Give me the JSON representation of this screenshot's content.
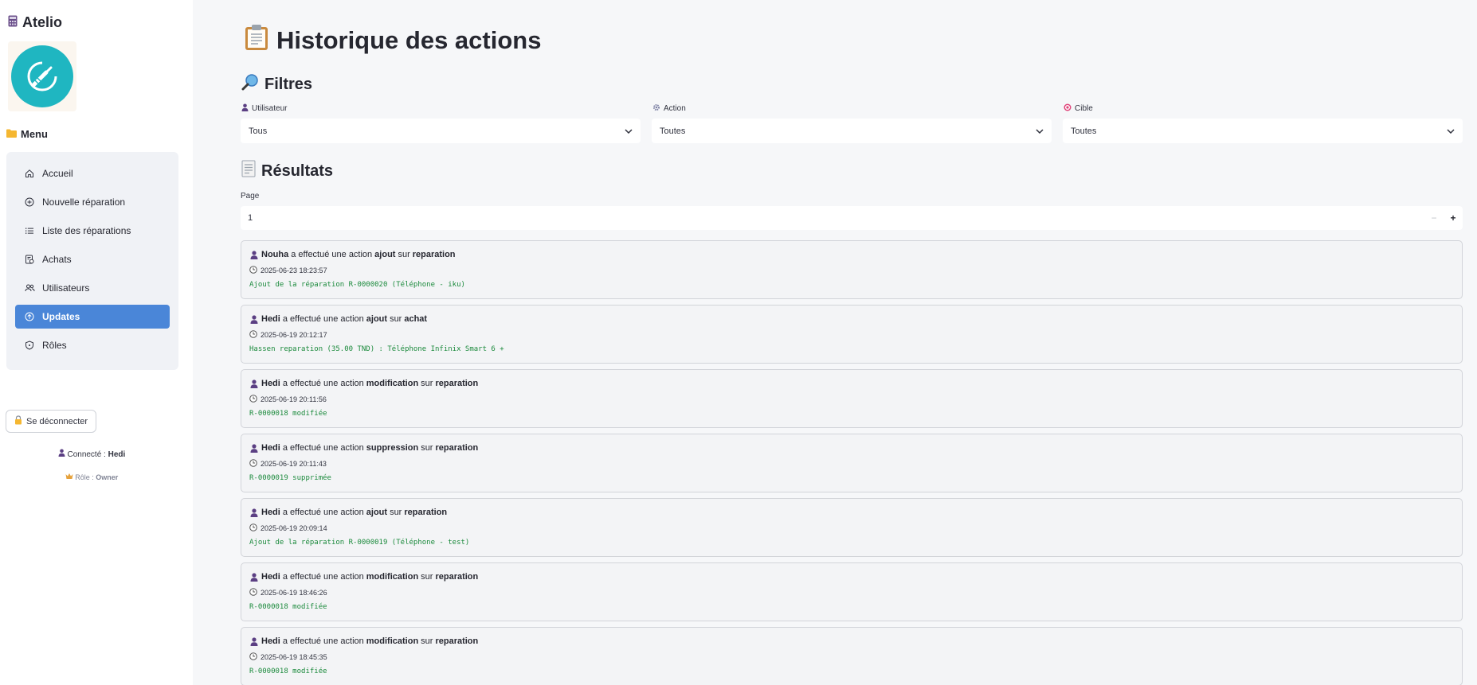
{
  "app": {
    "name": "Atelio",
    "menu_title": "Menu"
  },
  "sidebar": {
    "items": [
      {
        "label": "Accueil",
        "icon": "home-icon"
      },
      {
        "label": "Nouvelle réparation",
        "icon": "plus-circle-icon"
      },
      {
        "label": "Liste des réparations",
        "icon": "list-icon"
      },
      {
        "label": "Achats",
        "icon": "receipt-icon"
      },
      {
        "label": "Utilisateurs",
        "icon": "users-icon"
      },
      {
        "label": "Updates",
        "icon": "upload-circle-icon",
        "active": true
      },
      {
        "label": "Rôles",
        "icon": "shield-icon"
      }
    ],
    "logout_label": "Se déconnecter",
    "connected_label": "Connecté :",
    "connected_user": "Hedi",
    "role_label": "Rôle :",
    "role_value": "Owner"
  },
  "page": {
    "title": "Historique des actions",
    "filters_title": "Filtres",
    "filters": {
      "user": {
        "label": "Utilisateur",
        "value": "Tous"
      },
      "action": {
        "label": "Action",
        "value": "Toutes"
      },
      "target": {
        "label": "Cible",
        "value": "Toutes"
      }
    },
    "results_title": "Résultats",
    "page_label": "Page",
    "page_value": "1",
    "minus": "−",
    "plus": "+"
  },
  "entries": [
    {
      "user": "Nouha",
      "mid1": "a effectué une action",
      "action": "ajout",
      "mid2": "sur",
      "target": "reparation",
      "timestamp": "2025-06-23 18:23:57",
      "detail": "Ajout de la réparation R-0000020 (Téléphone - iku)"
    },
    {
      "user": "Hedi",
      "mid1": "a effectué une action",
      "action": "ajout",
      "mid2": "sur",
      "target": "achat",
      "timestamp": "2025-06-19 20:12:17",
      "detail": "Hassen reparation (35.00 TND) : Téléphone Infinix Smart 6 +"
    },
    {
      "user": "Hedi",
      "mid1": "a effectué une action",
      "action": "modification",
      "mid2": "sur",
      "target": "reparation",
      "timestamp": "2025-06-19 20:11:56",
      "detail": "R-0000018 modifiée"
    },
    {
      "user": "Hedi",
      "mid1": "a effectué une action",
      "action": "suppression",
      "mid2": "sur",
      "target": "reparation",
      "timestamp": "2025-06-19 20:11:43",
      "detail": "R-0000019 supprimée"
    },
    {
      "user": "Hedi",
      "mid1": "a effectué une action",
      "action": "ajout",
      "mid2": "sur",
      "target": "reparation",
      "timestamp": "2025-06-19 20:09:14",
      "detail": "Ajout de la réparation R-0000019 (Téléphone - test)"
    },
    {
      "user": "Hedi",
      "mid1": "a effectué une action",
      "action": "modification",
      "mid2": "sur",
      "target": "reparation",
      "timestamp": "2025-06-19 18:46:26",
      "detail": "R-0000018 modifiée"
    },
    {
      "user": "Hedi",
      "mid1": "a effectué une action",
      "action": "modification",
      "mid2": "sur",
      "target": "reparation",
      "timestamp": "2025-06-19 18:45:35",
      "detail": "R-0000018 modifiée"
    }
  ],
  "colors": {
    "accent": "#4a86d8",
    "logo": "#1fb6c1",
    "detail_text": "#1b8a3c"
  }
}
